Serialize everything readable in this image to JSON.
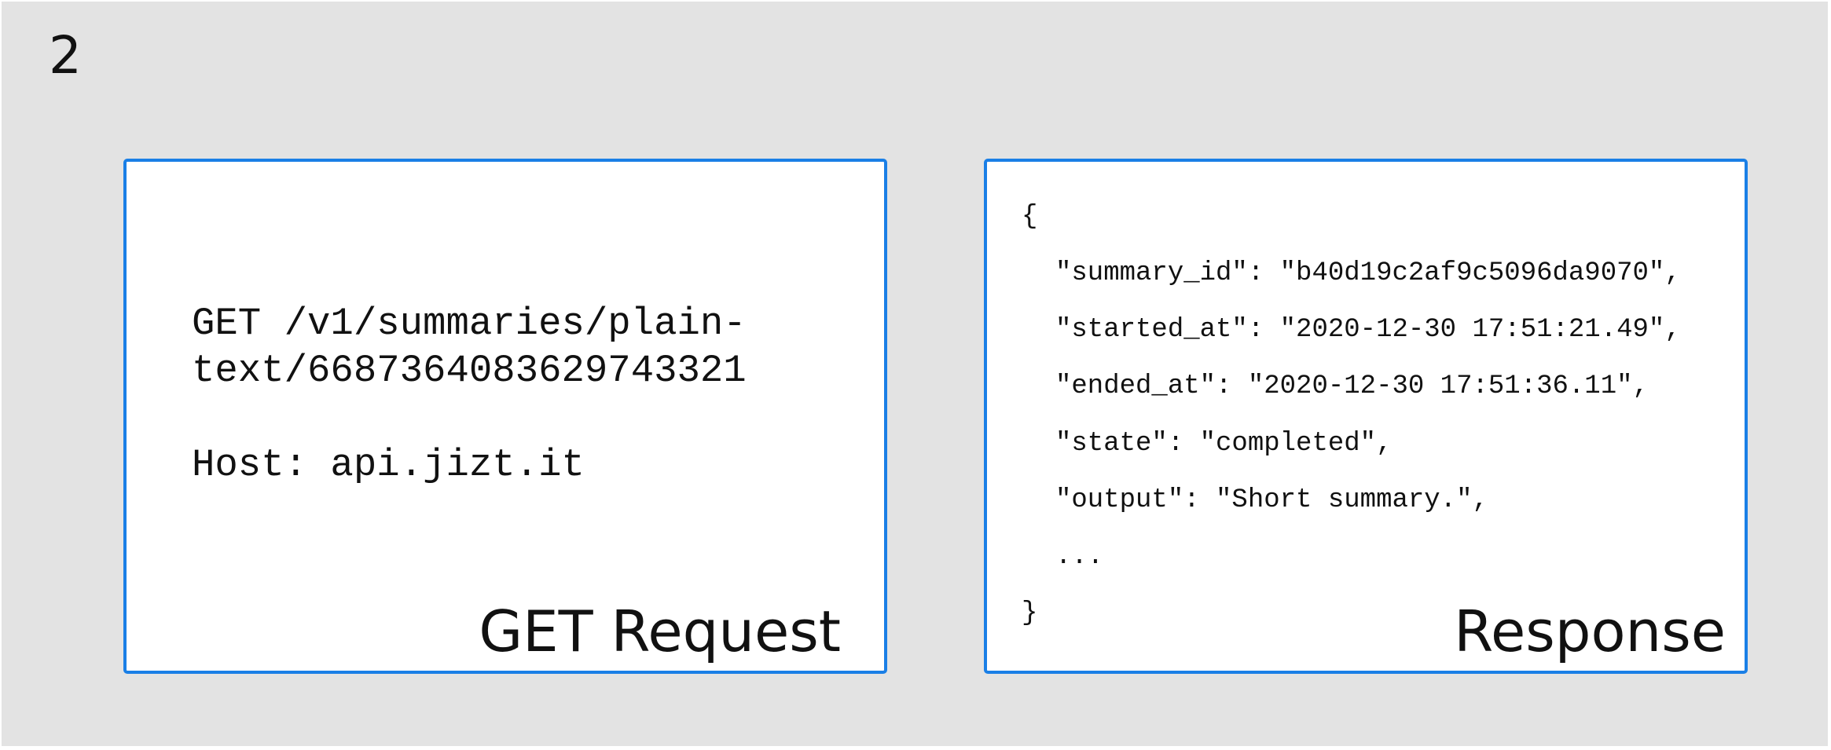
{
  "step_number": "2",
  "request": {
    "line1": "GET /v1/summaries/plain-",
    "line2": "text/6687364083629743321",
    "host": "Host: api.jizt.it",
    "caption": "GET Request"
  },
  "response": {
    "lines": [
      "{",
      "\"summary_id\": \"b40d19c2af9c5096da9070\",",
      "\"started_at\": \"2020-12-30 17:51:21.49\",",
      "\"ended_at\": \"2020-12-30 17:51:36.11\",",
      "\"state\": \"completed\",",
      "\"output\": \"Short summary.\",",
      "...",
      "}"
    ],
    "caption": "Response"
  },
  "colors": {
    "background": "#e3e3e3",
    "box_border": "#1a7fe6",
    "box_fill": "#ffffff",
    "text": "#111111"
  }
}
